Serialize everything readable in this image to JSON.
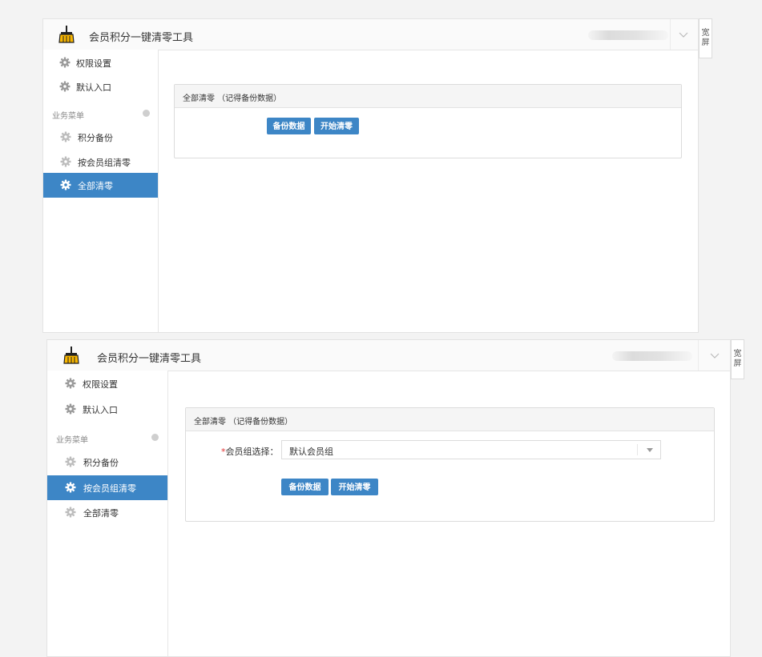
{
  "app": {
    "title": "会员积分一键清零工具",
    "widescreen": "宽屏"
  },
  "sidebar": {
    "items": [
      {
        "label": "权限设置",
        "icon": "gear-icon"
      },
      {
        "label": "默认入口",
        "icon": "gear-icon"
      }
    ],
    "section_label": "业务菜单",
    "menu": [
      {
        "label": "积分备份",
        "icon": "gear-icon"
      },
      {
        "label": "按会员组清零",
        "icon": "gear-icon"
      },
      {
        "label": "全部清零",
        "icon": "gear-icon"
      }
    ]
  },
  "screens": [
    {
      "active_menu": "全部清零",
      "card_title": "全部清零 （记得备份数据）",
      "buttons": {
        "backup": "备份数据",
        "start": "开始清零"
      }
    },
    {
      "active_menu": "按会员组清零",
      "card_title": "全部清零 （记得备份数据）",
      "form": {
        "group_label_required": "*",
        "group_label": "会员组选择：",
        "group_value": "默认会员组"
      },
      "buttons": {
        "backup": "备份数据",
        "start": "开始清零"
      }
    }
  ],
  "colors": {
    "accent": "#3d86c6",
    "required": "#e03131",
    "background": "#f3f3f3"
  }
}
